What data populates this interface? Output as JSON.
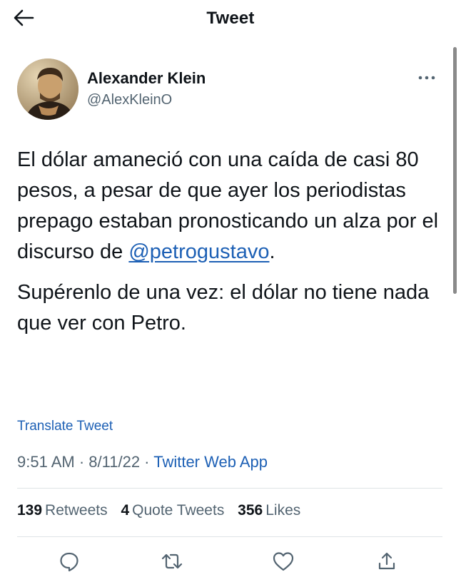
{
  "header": {
    "title": "Tweet",
    "back_icon": "arrow-left-icon"
  },
  "author": {
    "name": "Alexander Klein",
    "handle": "@AlexKleinO",
    "more_icon": "more-horizontal-icon"
  },
  "tweet": {
    "paragraph_1": {
      "text": "El dólar amaneció con una caída de casi 80 pesos, a pesar de que ayer los periodistas prepago estaban pronosticando un alza por el discurso de ",
      "mention": "@petrogustavo",
      "suffix": "."
    },
    "paragraph_2": "Supérenlo de una vez: el dólar no tiene nada que ver con Petro."
  },
  "translate_label": "Translate Tweet",
  "meta": {
    "time": "9:51 AM",
    "sep1": " · ",
    "date": "8/11/22",
    "sep2": " · ",
    "source": "Twitter Web App"
  },
  "stats": {
    "retweets_count": "139",
    "retweets_label": "Retweets",
    "quotes_count": "4",
    "quotes_label": "Quote Tweets",
    "likes_count": "356",
    "likes_label": "Likes"
  },
  "actions": [
    "reply-icon",
    "retweet-icon",
    "like-icon",
    "share-icon"
  ],
  "colors": {
    "link": "#1d60b5",
    "secondary_text": "#536471",
    "primary_text": "#0f1419",
    "divider": "#dfe3e6"
  }
}
